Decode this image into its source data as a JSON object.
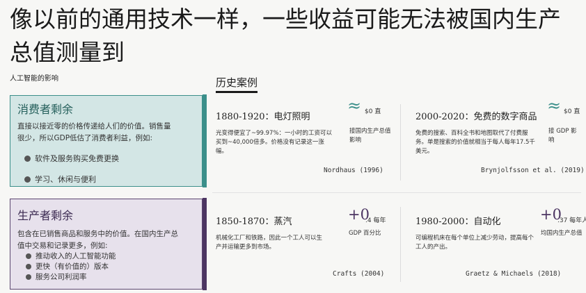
{
  "title": "像以前的通用技术一样，一些收益可能无法被国内生产总值测量到",
  "impact_label": "人工智能的影响",
  "history_heading": "历史案例",
  "consumer": {
    "title": "消费者剩余",
    "desc": "直接以接近零的价格传递给人们的价值。销售量很少，所以GDP低估了消费者利益，例如:",
    "bullets": [
      "软件及服务购买免费更换",
      "学习、休闲与便利"
    ]
  },
  "producer": {
    "title": "生产者剩余",
    "desc": "包含在已销售商品和服务中的价值。在国内生产总值中交易和记录更多，例如:",
    "bullets": [
      "推动收入的人工智能功能",
      "更快（有价值的）版本",
      "服务公司利润率"
    ]
  },
  "cases": {
    "electric": {
      "title": "1880-1920：电灯照明",
      "body": "光变得便宜了~99.97%：一小时的工资可以买到~40,000倍多。价格没有记录这一涨幅。",
      "symbol": "≈",
      "value": "$0 直",
      "note": "接国内生产总值影响",
      "cite": "Nordhaus (1996)"
    },
    "digital": {
      "title": "2000-2020：免费的数字商品",
      "body": "免费的搜索、百科全书和地图取代了付费服务。单是搜索的价值就相当于每人每年17.5千美元。",
      "symbol": "≈",
      "value": "$0 直",
      "note": "接 GDP 影响",
      "cite": "Brynjolfsson et al. (2019)"
    },
    "steam": {
      "title": "1850-1870：蒸汽",
      "body": "机械化工厂和铁路，因此一个工人可以生产并运输更多到市场。",
      "symbol": "+0",
      "value": ".4 每年",
      "note": "GDP 百分比",
      "cite": "Crafts (2004)"
    },
    "automation": {
      "title": "1980-2000：自动化",
      "body": "可编程机床在每个单位上减少劳动，提高每个工人的产出。",
      "symbol": "+0",
      "value": ".37 每年人",
      "note": "均国内生产总值",
      "cite": "Graetz & Michaels (2018)"
    }
  },
  "colors": {
    "consumer_accent": "#3b8f8a",
    "consumer_bg": "#d3e6e5",
    "producer_accent": "#4c3562",
    "producer_bg": "#e7e1ec"
  }
}
